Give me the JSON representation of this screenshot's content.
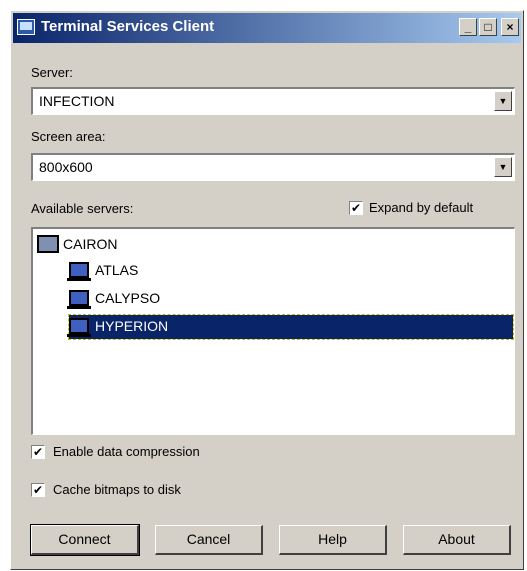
{
  "window": {
    "title": "Terminal Services Client"
  },
  "titlebar": {
    "min": "_",
    "max": "□",
    "close": "×"
  },
  "server": {
    "label": "Server:",
    "value": "INFECTION"
  },
  "screen_area": {
    "label": "Screen area:",
    "value": "800x600"
  },
  "available": {
    "label": "Available servers:"
  },
  "expand_default": {
    "label": "Expand by default",
    "checked": true
  },
  "tree": {
    "domain": "CAIRON",
    "servers": [
      "ATLAS",
      "CALYPSO",
      "HYPERION"
    ],
    "selected": "HYPERION"
  },
  "options": {
    "compression": {
      "label": "Enable data compression",
      "checked": true
    },
    "cache": {
      "label": "Cache bitmaps to disk",
      "checked": true
    }
  },
  "buttons": {
    "connect": "Connect",
    "cancel": "Cancel",
    "help": "Help",
    "about": "About"
  },
  "icons": {
    "checkmark": "✔",
    "dropdown": "▼"
  }
}
